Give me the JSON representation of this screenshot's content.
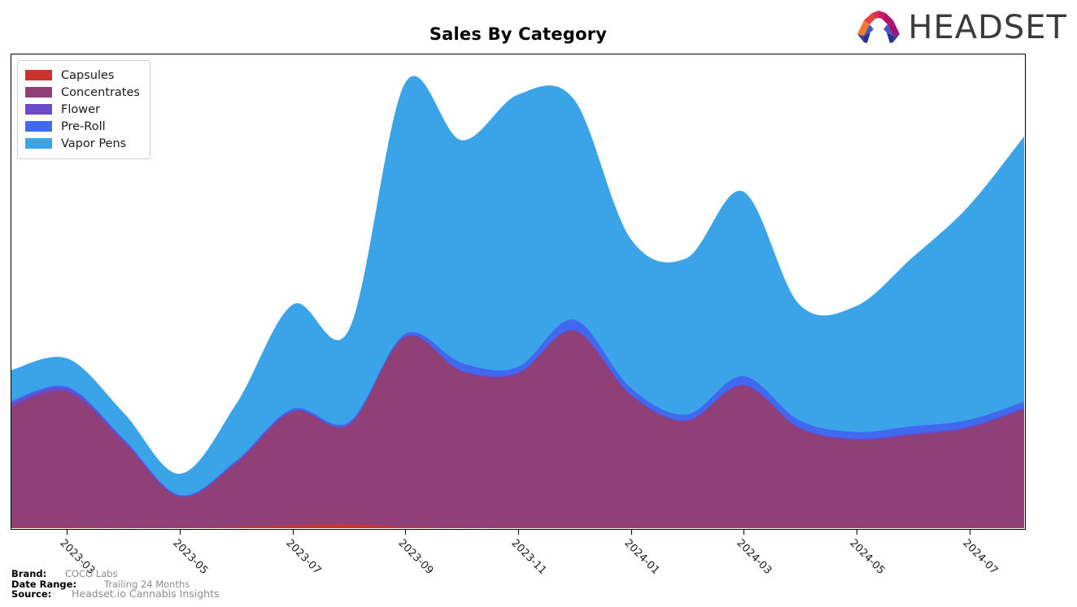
{
  "header": {
    "title": "Sales By Category",
    "logo_word": "HEADSET",
    "logo_icon": "headset-arch-logo"
  },
  "legend": {
    "position": "top-left",
    "items": [
      {
        "label": "Capsules",
        "color": "#C9352E"
      },
      {
        "label": "Concentrates",
        "color": "#8F4077"
      },
      {
        "label": "Flower",
        "color": "#6B49C8"
      },
      {
        "label": "Pre-Roll",
        "color": "#4169F0"
      },
      {
        "label": "Vapor Pens",
        "color": "#3BA3E8"
      }
    ]
  },
  "footer": {
    "brand_key": "Brand:",
    "brand_value": "COCO Labs",
    "date_range_key": "Date Range:",
    "date_range_value": "Trailing 24 Months",
    "source_key": "Source:",
    "source_value": "Headset.io Cannabis Insights"
  },
  "chart_data": {
    "type": "area",
    "stacked": true,
    "title": "Sales By Category",
    "xlabel": "",
    "ylabel": "",
    "grid": false,
    "legend_position": "upper left",
    "x_tick_labels": [
      "2023-03",
      "2023-05",
      "2023-07",
      "2023-09",
      "2023-11",
      "2024-01",
      "2024-03",
      "2024-05",
      "2024-07"
    ],
    "x": [
      "2023-02",
      "2023-03",
      "2023-04",
      "2023-05",
      "2023-06",
      "2023-07",
      "2023-08",
      "2023-09",
      "2023-10",
      "2023-11",
      "2023-12",
      "2024-01",
      "2024-02",
      "2024-03",
      "2024-04",
      "2024-05",
      "2024-06",
      "2024-07",
      "2024-08"
    ],
    "series": [
      {
        "name": "Capsules",
        "color": "#C9352E",
        "values": [
          0.2,
          0.2,
          0.1,
          0.1,
          0.3,
          0.6,
          0.8,
          0.3,
          0.1,
          0.1,
          0.1,
          0.1,
          0.1,
          0.1,
          0.1,
          0.1,
          0.1,
          0.1,
          0.1
        ]
      },
      {
        "name": "Concentrates",
        "color": "#8F4077",
        "values": [
          25.5,
          28.5,
          18.0,
          6.5,
          13.5,
          24.0,
          21.0,
          40.0,
          33.0,
          32.5,
          41.5,
          28.0,
          22.5,
          30.0,
          21.0,
          18.5,
          19.5,
          21.0,
          25.0
        ]
      },
      {
        "name": "Flower",
        "color": "#6B49C8",
        "values": [
          0.8,
          0.7,
          0.4,
          0.2,
          0.2,
          0.2,
          0.2,
          0.2,
          0.2,
          0.2,
          0.2,
          0.2,
          0.2,
          0.2,
          0.2,
          0.3,
          0.4,
          0.3,
          0.3
        ]
      },
      {
        "name": "Pre-Roll",
        "color": "#4169F0",
        "values": [
          0.4,
          0.4,
          0.3,
          0.2,
          0.3,
          0.4,
          0.4,
          0.5,
          1.6,
          1.2,
          2.2,
          1.4,
          1.2,
          1.8,
          1.5,
          1.4,
          1.5,
          1.4,
          1.3
        ]
      },
      {
        "name": "Vapor Pens",
        "color": "#3BA3E8",
        "values": [
          6.5,
          6.0,
          5.5,
          4.5,
          12.0,
          22.0,
          19.5,
          53.0,
          47.0,
          57.5,
          46.5,
          31.5,
          33.0,
          39.0,
          24.5,
          26.5,
          35.5,
          45.0,
          56.0
        ]
      }
    ],
    "ylim": [
      0,
      100
    ],
    "xlim_labels": [
      "2023-02",
      "2024-08"
    ]
  }
}
